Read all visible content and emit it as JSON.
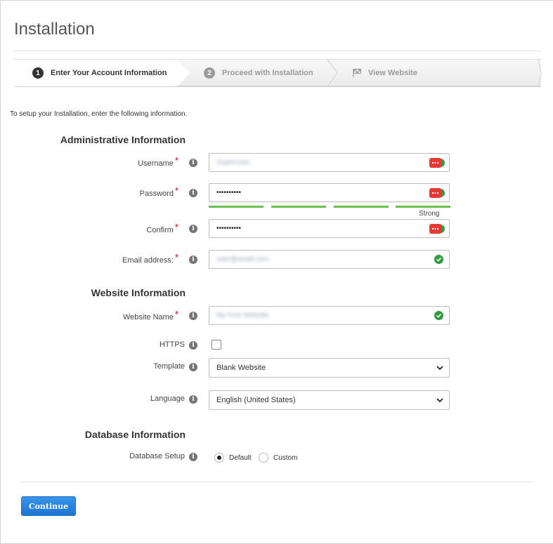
{
  "page": {
    "title": "Installation",
    "intro": "To setup your Installation, enter the following information."
  },
  "wizard": {
    "steps": [
      {
        "num": "1",
        "label": "Enter Your Account Information",
        "state": "active"
      },
      {
        "num": "2",
        "label": "Proceed with Installation",
        "state": "inactive"
      },
      {
        "num": "",
        "label": "View Website",
        "state": "inactive",
        "icon": "flag-icon"
      }
    ]
  },
  "sections": {
    "admin": "Administrative Information",
    "website": "Website Information",
    "database": "Database Information"
  },
  "fields": {
    "username": {
      "label": "Username",
      "value": "SuperUser"
    },
    "password": {
      "label": "Password",
      "value": "••••••••••",
      "strength": "Strong"
    },
    "confirm": {
      "label": "Confirm",
      "value": "••••••••••"
    },
    "email": {
      "label": "Email address:",
      "value": "user@email.com"
    },
    "website_name": {
      "label": "Website Name",
      "value": "My First Website"
    },
    "https": {
      "label": "HTTPS",
      "checked": false
    },
    "template": {
      "label": "Template",
      "value": "Blank Website"
    },
    "language": {
      "label": "Language",
      "value": "English (United States)"
    },
    "db_setup": {
      "label": "Database Setup",
      "options": [
        "Default",
        "Custom"
      ],
      "selected": "Default"
    }
  },
  "actions": {
    "continue": "Continue"
  },
  "colors": {
    "accent": "#1c74d1",
    "success": "#2e9c3f",
    "required": "#d0021b",
    "strength_bar": "#6cbf52",
    "password_badge": "#e53935"
  }
}
